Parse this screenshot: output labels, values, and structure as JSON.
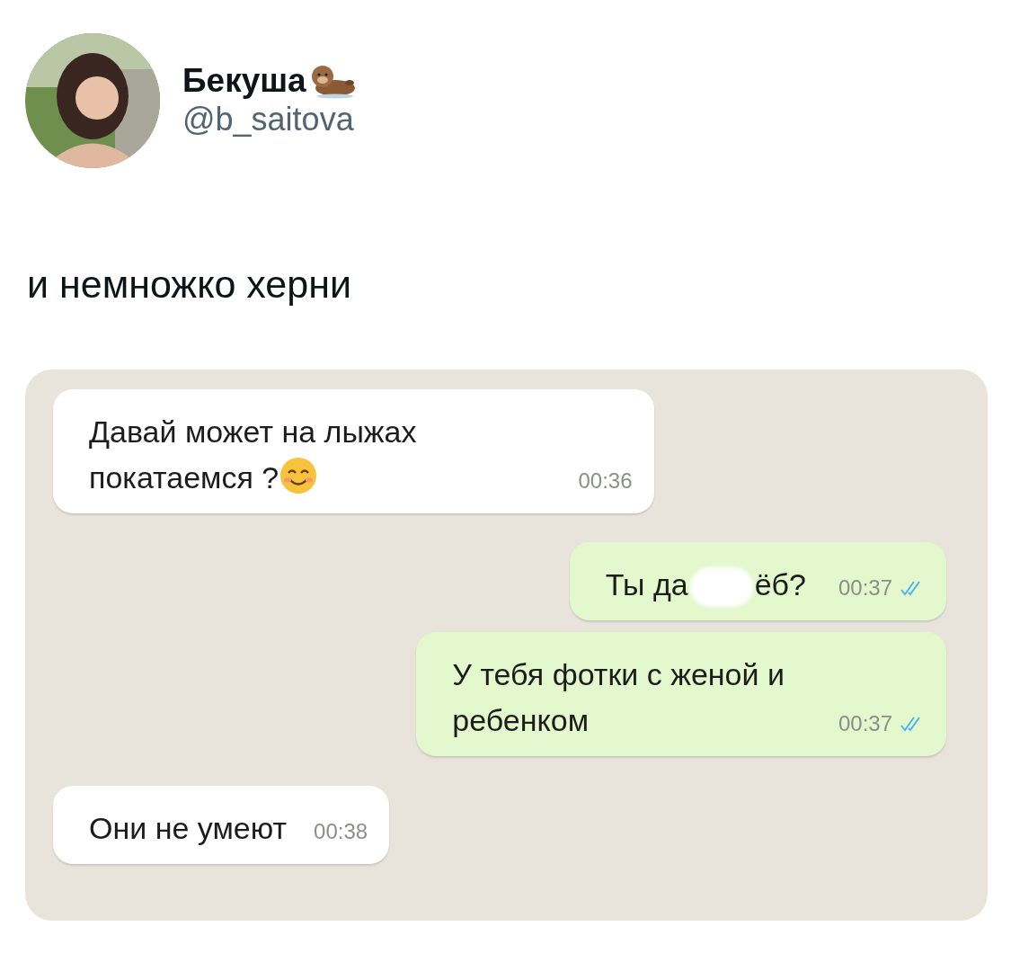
{
  "author": {
    "name": "Бекуша",
    "handle": "@b_saitova"
  },
  "tweet": {
    "text": "и немножко херни"
  },
  "chat": {
    "messages": [
      {
        "kind": "in",
        "text": "Давай может на лыжах\nпокатаемся ?",
        "emoji": true,
        "time": "00:36"
      },
      {
        "kind": "out",
        "text": "Ты да",
        "text_after": "ёб?",
        "hidden_part": true,
        "time": "00:37",
        "read": true
      },
      {
        "kind": "out",
        "text": "У тебя фотки с женой и\nребенком",
        "time": "00:37",
        "read": true
      },
      {
        "kind": "in",
        "text": "Они не умеют",
        "time": "00:38"
      }
    ]
  }
}
